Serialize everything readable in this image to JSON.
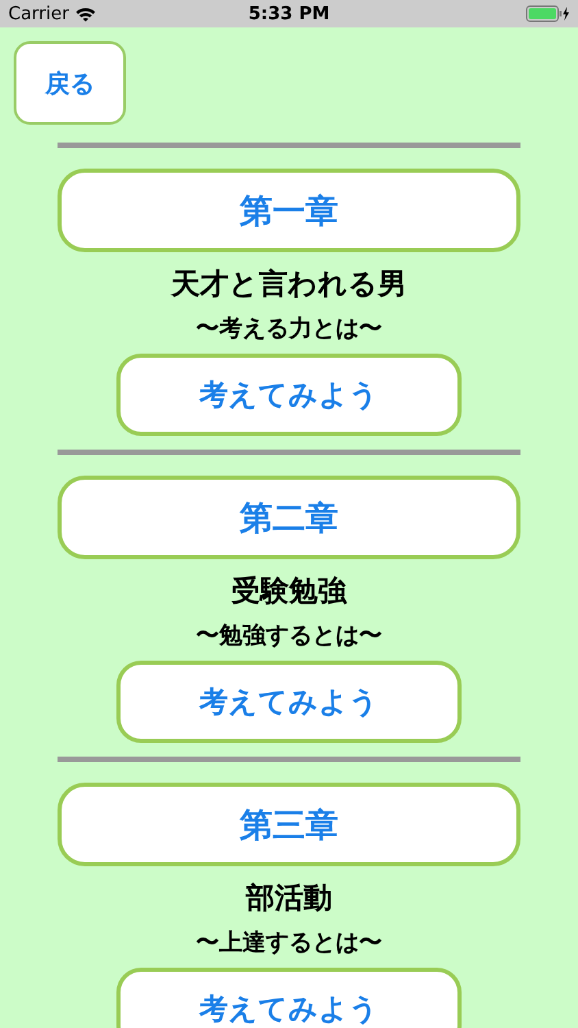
{
  "status_bar": {
    "carrier": "Carrier",
    "time": "5:33 PM"
  },
  "back_button": {
    "label": "戻る"
  },
  "chapters": [
    {
      "chapter": "第一章",
      "title": "天才と言われる男",
      "subtitle": "〜考える力とは〜",
      "action": "考えてみよう"
    },
    {
      "chapter": "第二章",
      "title": "受験勉強",
      "subtitle": "〜勉強するとは〜",
      "action": "考えてみよう"
    },
    {
      "chapter": "第三章",
      "title": "部活動",
      "subtitle": "〜上達するとは〜",
      "action": "考えてみよう"
    }
  ]
}
